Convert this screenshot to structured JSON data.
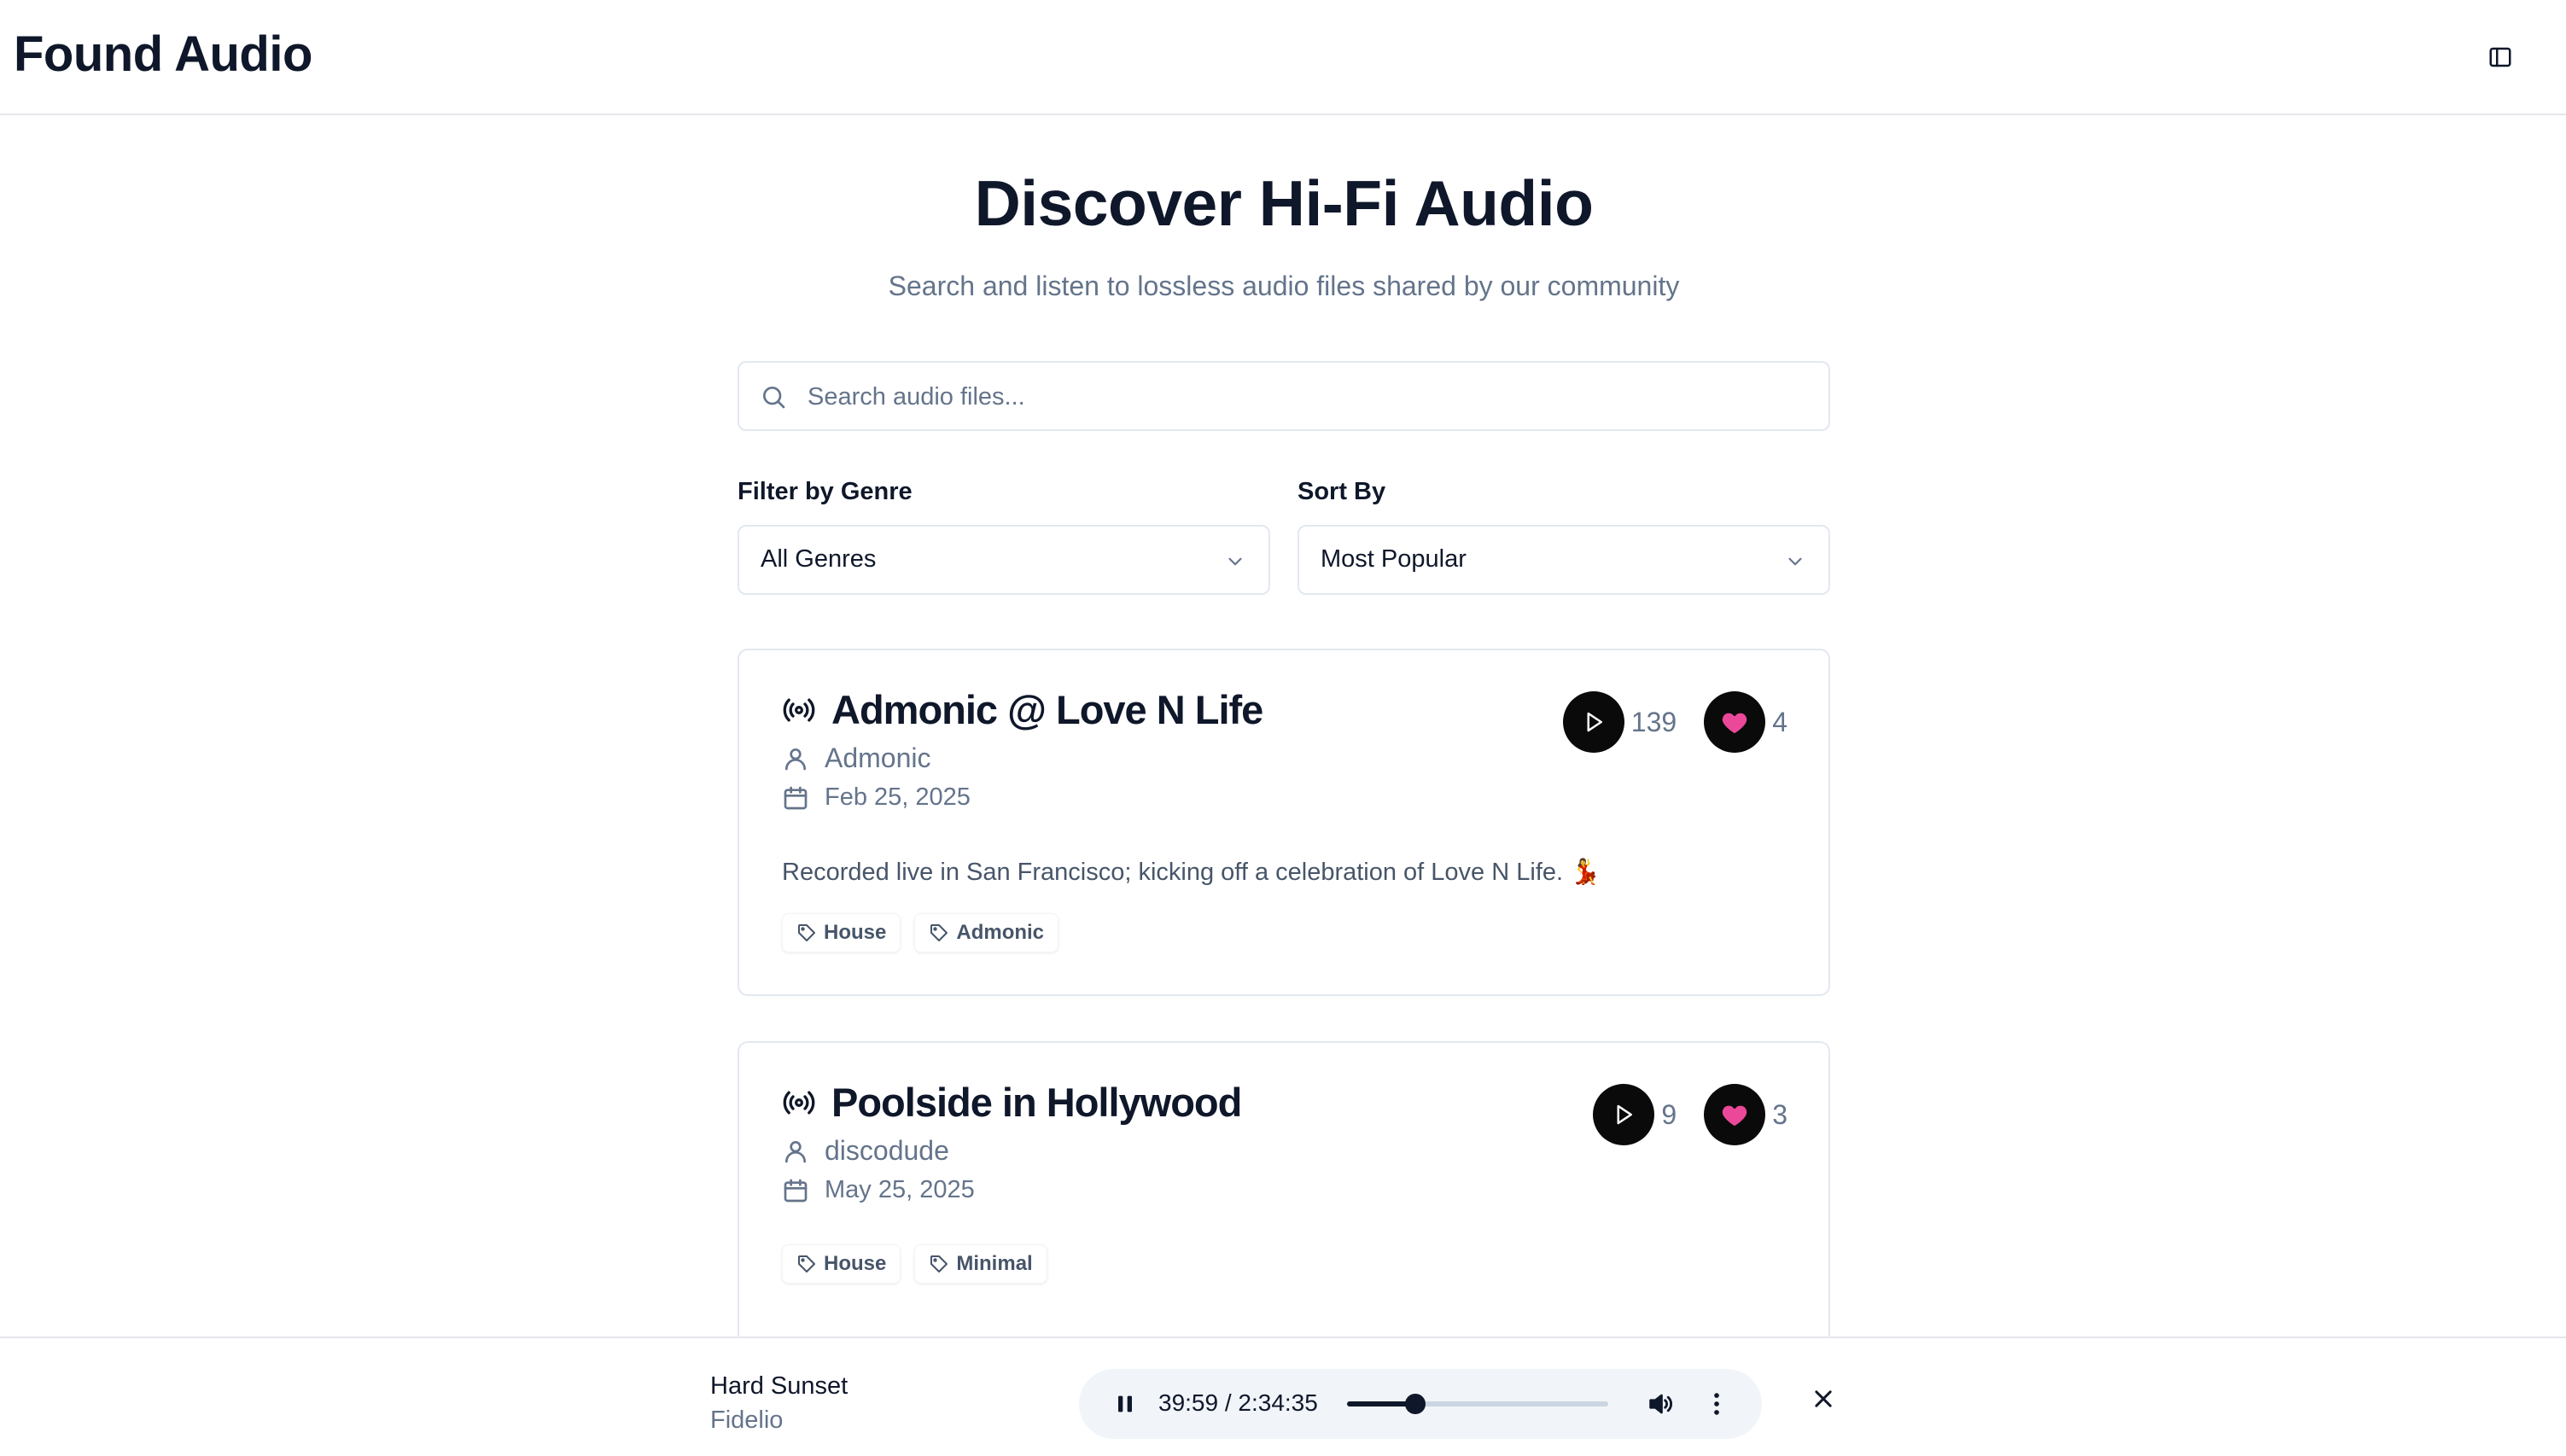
{
  "header": {
    "brand": "Found Audio",
    "sidebar_toggle_icon": "panel-left-icon"
  },
  "hero": {
    "title": "Discover Hi-Fi Audio",
    "subtitle": "Search and listen to lossless audio files shared by our community"
  },
  "search": {
    "placeholder": "Search audio files...",
    "value": "",
    "icon": "search-icon"
  },
  "filters": {
    "genre_label": "Filter by Genre",
    "genre_value": "All Genres",
    "sort_label": "Sort By",
    "sort_value": "Most Popular"
  },
  "cards": [
    {
      "title": "Admonic @ Love N Life",
      "artist": "Admonic",
      "date": "Feb 25, 2025",
      "description": "Recorded live in San Francisco; kicking off a celebration of Love N Life. 💃",
      "plays": "139",
      "likes": "4",
      "tags": [
        "House",
        "Admonic"
      ]
    },
    {
      "title": "Poolside in Hollywood",
      "artist": "discodude",
      "date": "May 25, 2025",
      "description": "",
      "plays": "9",
      "likes": "3",
      "tags": [
        "House",
        "Minimal"
      ]
    }
  ],
  "player": {
    "title": "Hard Sunset",
    "artist": "Fidelio",
    "time": "39:59 / 2:34:35",
    "progress_fraction": 0.26
  },
  "colors": {
    "accent_heart": "#ec4899",
    "button_dark": "#0a0a0a",
    "muted_text": "#64748b",
    "border": "#e2e8f0"
  }
}
